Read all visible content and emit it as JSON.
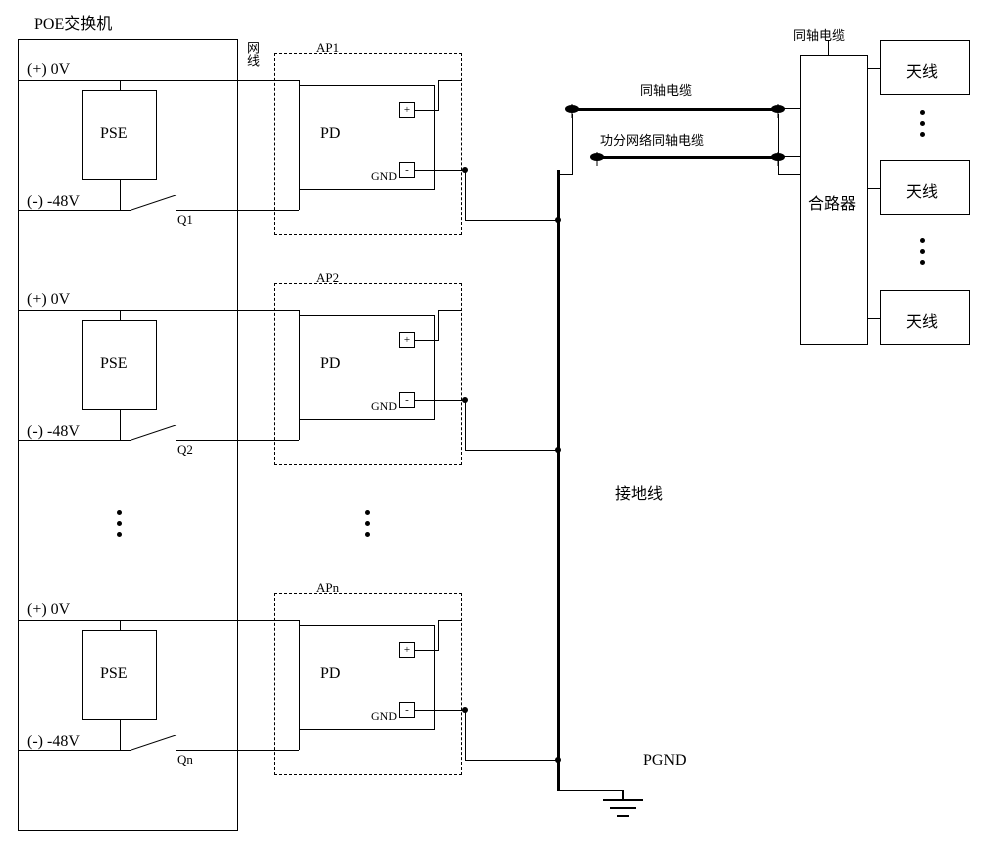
{
  "title": "POE交换机",
  "net_line_label": "网线",
  "coax_label": "同轴电缆",
  "coax_split_label": "功分网络同轴电缆",
  "coax_label_top_right": "同轴电缆",
  "combiner_label": "合路器",
  "ground_line_label": "接地线",
  "pgnd_label": "PGND",
  "antenna_label": "天线",
  "blocks": {
    "pse": "PSE",
    "pd": "PD",
    "gnd": "GND",
    "plus": "+",
    "minus": "-"
  },
  "aps": [
    {
      "name": "AP1",
      "q": "Q1",
      "vplus": "(+) 0V",
      "vminus": "(-) -48V"
    },
    {
      "name": "AP2",
      "q": "Q2",
      "vplus": "(+) 0V",
      "vminus": "(-) -48V"
    },
    {
      "name": "APn",
      "q": "Qn",
      "vplus": "(+) 0V",
      "vminus": "(-) -48V"
    }
  ]
}
